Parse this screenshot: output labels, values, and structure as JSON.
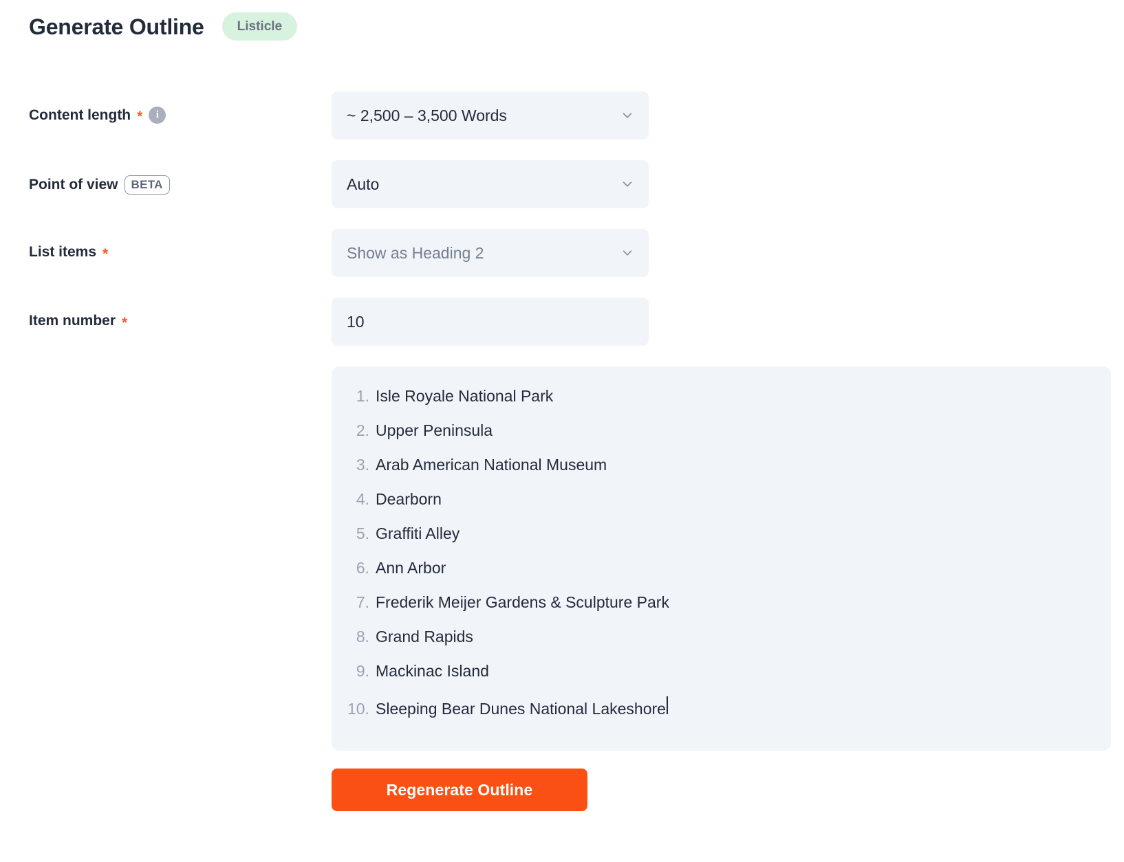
{
  "header": {
    "title": "Generate Outline",
    "badge": "Listicle"
  },
  "fields": {
    "content_length": {
      "label": "Content length",
      "required_marker": "*",
      "info_icon_glyph": "i",
      "value": "~ 2,500 – 3,500 Words"
    },
    "point_of_view": {
      "label": "Point of view",
      "beta_badge": "BETA",
      "value": "Auto"
    },
    "list_items": {
      "label": "List items",
      "required_marker": "*",
      "value": "Show as Heading 2"
    },
    "item_number": {
      "label": "Item number",
      "required_marker": "*",
      "value": "10"
    }
  },
  "outline_list": {
    "items": [
      {
        "number": "1.",
        "text": "Isle Royale National Park"
      },
      {
        "number": "2.",
        "text": "Upper Peninsula"
      },
      {
        "number": "3.",
        "text": "Arab American National Museum"
      },
      {
        "number": "4.",
        "text": "Dearborn"
      },
      {
        "number": "5.",
        "text": "Graffiti Alley"
      },
      {
        "number": "6.",
        "text": "Ann Arbor"
      },
      {
        "number": "7.",
        "text": "Frederik Meijer Gardens & Sculpture Park"
      },
      {
        "number": "8.",
        "text": "Grand Rapids"
      },
      {
        "number": "9.",
        "text": "Mackinac Island"
      },
      {
        "number": "10.",
        "text": "Sleeping Bear Dunes National Lakeshore"
      }
    ]
  },
  "actions": {
    "regenerate_label": "Regenerate Outline"
  },
  "colors": {
    "accent_orange": "#fb5014",
    "required_star": "#fb5a23",
    "badge_green_bg": "#d7f2df",
    "field_bg": "#f1f4f9",
    "text_dark": "#232b3b",
    "text_muted": "#757f91",
    "list_number": "#9aa3b2"
  }
}
